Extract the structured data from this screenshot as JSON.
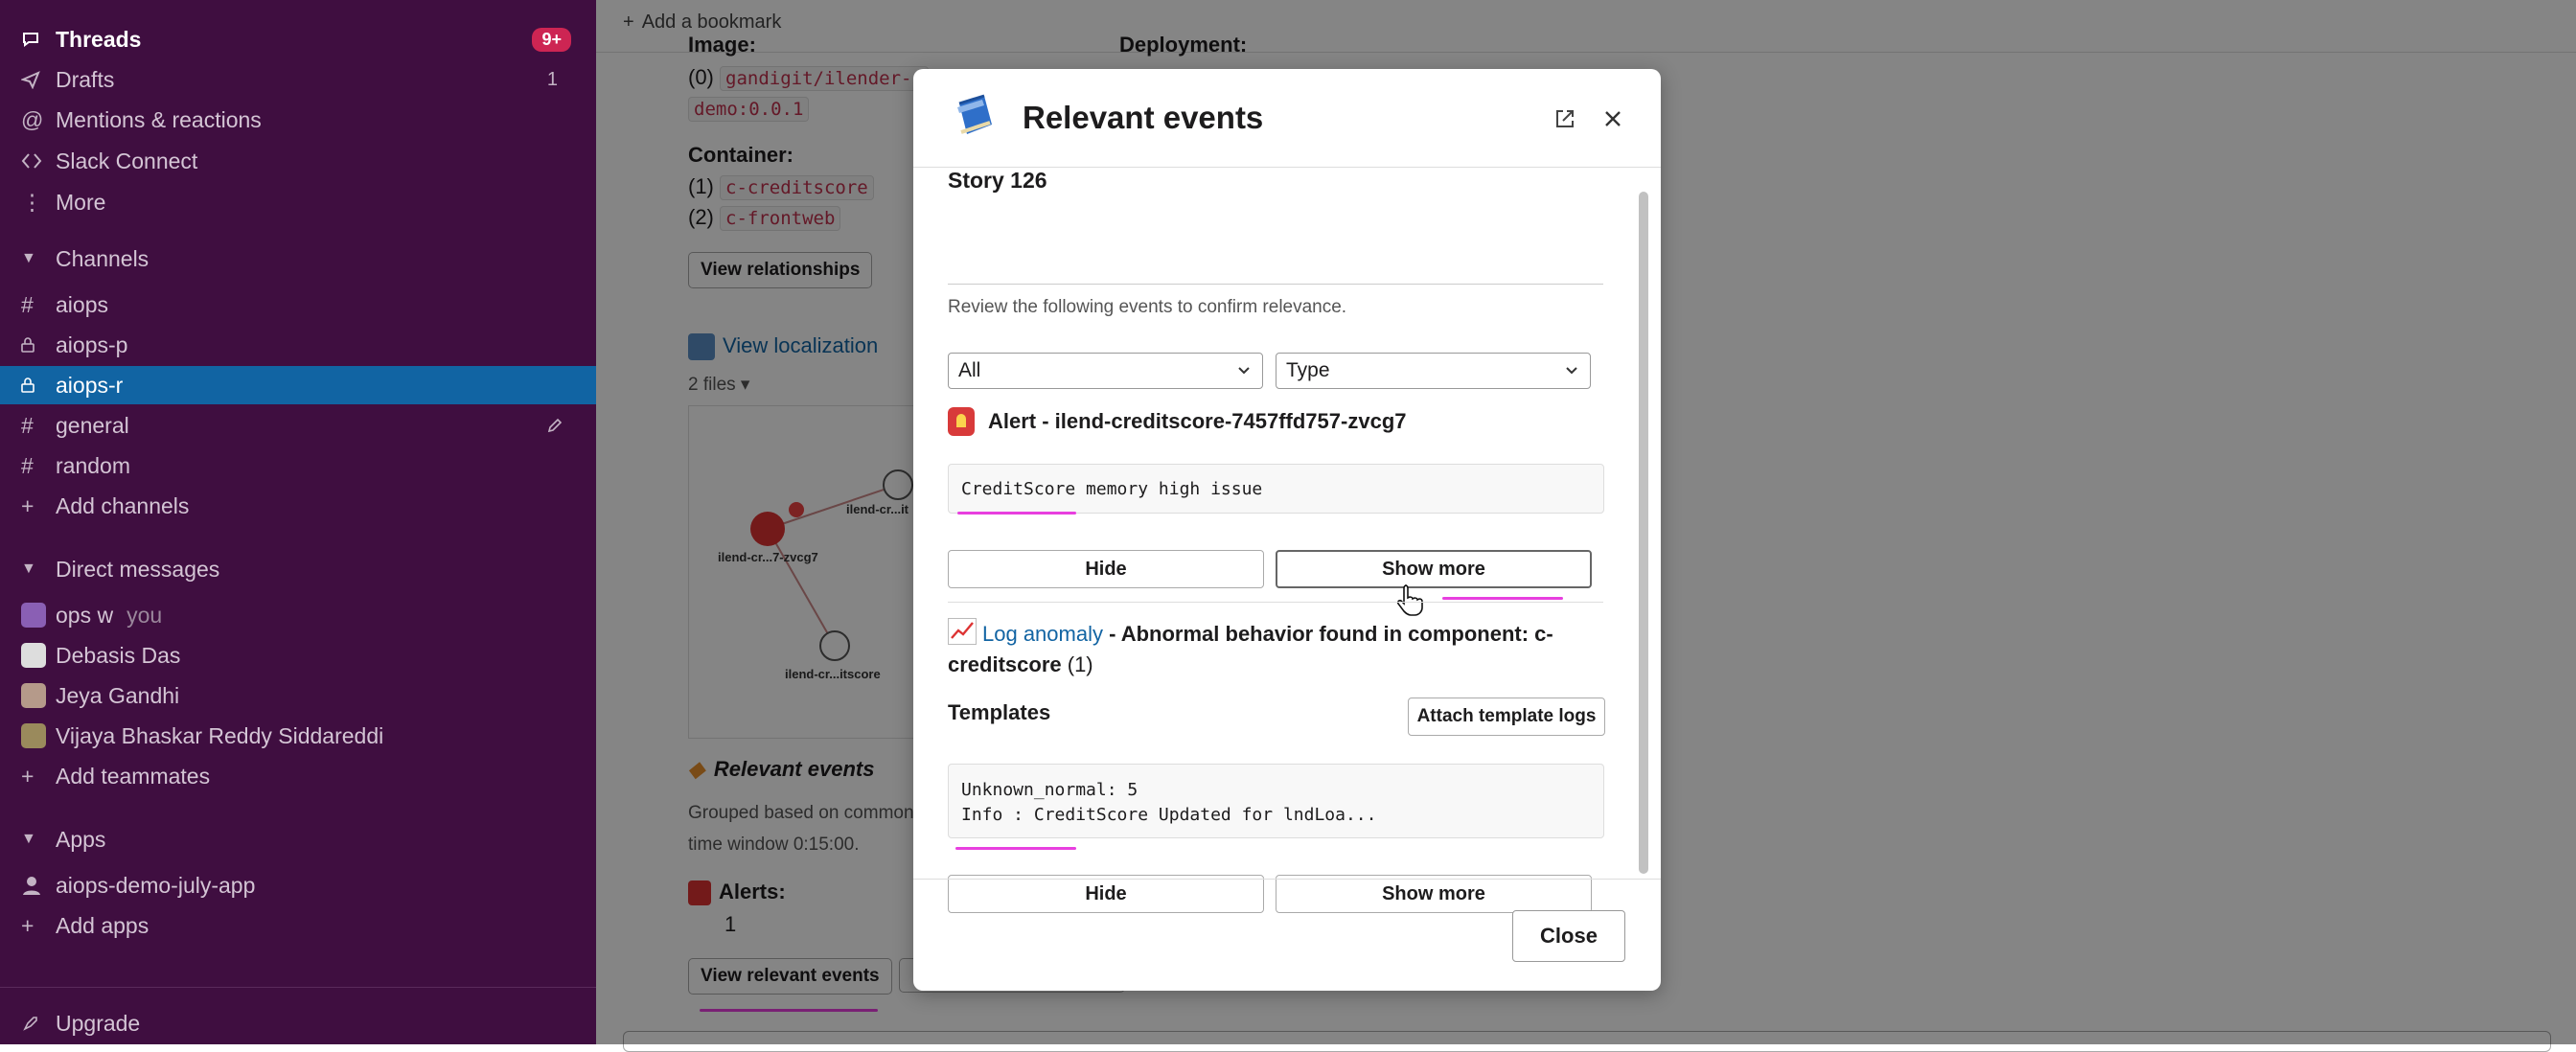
{
  "sidebar": {
    "threads_label": "Threads",
    "threads_badge": "9+",
    "drafts_label": "Drafts",
    "drafts_count": "1",
    "mentions_label": "Mentions & reactions",
    "connect_label": "Slack Connect",
    "more_label": "More",
    "channels_header": "Channels",
    "channels": [
      "aiops",
      "aiops-p",
      "aiops-r",
      "general",
      "random"
    ],
    "add_channels": "Add channels",
    "dm_header": "Direct messages",
    "dms": [
      "ops w",
      "Debasis Das",
      "Jeya Gandhi",
      "Vijaya Bhaskar Reddy Siddareddi"
    ],
    "dm_you": "you",
    "add_teammates": "Add teammates",
    "apps_header": "Apps",
    "apps": [
      "aiops-demo-july-app"
    ],
    "add_apps": "Add apps",
    "upgrade": "Upgrade"
  },
  "main": {
    "bookmark": "Add a bookmark",
    "image_label": "Image:",
    "deployment_label": "Deployment:",
    "image_idx": "(0)",
    "image_val1": "gandigit/ilender-c",
    "image_val2": "demo:0.0.1",
    "container_label": "Container:",
    "container_idx1": "(1)",
    "container_val1": "c-creditscore",
    "container_idx2": "(2)",
    "container_val2": "c-frontweb",
    "view_relationships": "View relationships",
    "view_localization": "View localization",
    "files": "2 files",
    "graph_nodes": [
      "ilend-cr...7-zvcg7",
      "ilend-cr...it",
      "ilend-cr...itscore"
    ],
    "relevant_events": "Relevant events",
    "grouped_text1": "Grouped based on common",
    "grouped_text2": "time window 0:15:00.",
    "alerts_label": "Alerts:",
    "alerts_count": "1",
    "view_relevant_events": "View relevant events"
  },
  "modal": {
    "title": "Relevant events",
    "story": "Story 126",
    "description": "Review the following events to confirm relevance.",
    "filter_all": "All",
    "filter_type": "Type",
    "alert_title": "Alert - ilend-creditscore-7457ffd757-zvcg7",
    "alert_message": "CreditScore memory high issue",
    "hide_label": "Hide",
    "show_more_label": "Show more",
    "log_link": "Log anomaly",
    "log_title": " - Abnormal behavior found in component: c-creditscore",
    "log_count": "(1)",
    "templates_label": "Templates",
    "attach_logs": "Attach template logs",
    "template_line1": "Unknown_normal: 5",
    "template_line2": "Info : CreditScore Updated for lndLoa...",
    "close_label": "Close"
  },
  "colors": {
    "sidebar_bg": "#3f0e40",
    "selected": "#1164a3",
    "badge": "#cd2553",
    "highlight_underline": "#e83fdf",
    "link": "#1264a3"
  }
}
